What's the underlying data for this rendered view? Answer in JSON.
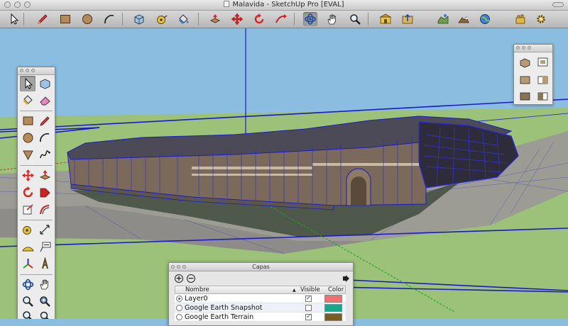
{
  "window": {
    "title": "Malavida - SketchUp Pro [EVAL]"
  },
  "toolbar": {
    "items": [
      {
        "name": "select-tool",
        "icon": "arrow-cursor-icon",
        "pos": 0
      },
      {
        "name": "line-tool",
        "icon": "pencil-icon",
        "pos": 1
      },
      {
        "name": "rectangle-tool",
        "icon": "rectangle-icon",
        "pos": 2
      },
      {
        "name": "circle-tool",
        "icon": "circle-icon",
        "pos": 3
      },
      {
        "name": "arc-tool",
        "icon": "arc-icon",
        "pos": 4
      },
      {
        "name": "make-component-tool",
        "icon": "component-icon",
        "pos": 5
      },
      {
        "name": "tape-measure-tool",
        "icon": "tape-measure-icon",
        "pos": 6
      },
      {
        "name": "paint-bucket-tool",
        "icon": "paint-bucket-icon",
        "pos": 7
      },
      {
        "name": "push-pull-tool",
        "icon": "push-pull-icon",
        "pos": 8
      },
      {
        "name": "move-tool",
        "icon": "move-icon",
        "pos": 9
      },
      {
        "name": "rotate-tool",
        "icon": "rotate-icon",
        "pos": 10
      },
      {
        "name": "follow-me-tool",
        "icon": "follow-me-icon",
        "pos": 11
      },
      {
        "name": "orbit-tool",
        "icon": "orbit-icon",
        "pos": 12
      },
      {
        "name": "pan-tool",
        "icon": "hand-icon",
        "pos": 13
      },
      {
        "name": "zoom-tool",
        "icon": "magnifier-icon",
        "pos": 14
      },
      {
        "name": "get-models-tool",
        "icon": "warehouse-icon",
        "pos": 15
      },
      {
        "name": "share-model-tool",
        "icon": "share-model-icon",
        "pos": 16
      },
      {
        "name": "get-current-view-tool",
        "icon": "earth-view-icon",
        "pos": 17
      },
      {
        "name": "toggle-terrain-tool",
        "icon": "terrain-icon",
        "pos": 18
      },
      {
        "name": "extension-warehouse-tool",
        "icon": "extension-icon",
        "pos": 19
      }
    ]
  },
  "layers_dialog": {
    "title": "Capas",
    "columns": {
      "name": "Nombre",
      "visible": "Visible",
      "color": "Color"
    },
    "rows": [
      {
        "name": "Layer0",
        "active": true,
        "visible": true,
        "color": "#f07070"
      },
      {
        "name": "Google Earth Snapshot",
        "active": false,
        "visible": false,
        "color": "#1aa68c"
      },
      {
        "name": "Google Earth Terrain",
        "active": false,
        "visible": true,
        "color": "#7a5c22"
      }
    ]
  },
  "colors": {
    "sky": "#8bbde0",
    "ground": "#9cc178",
    "edge_blue": "#1a1acc",
    "toolbar_bg": "#c6c6c6"
  }
}
